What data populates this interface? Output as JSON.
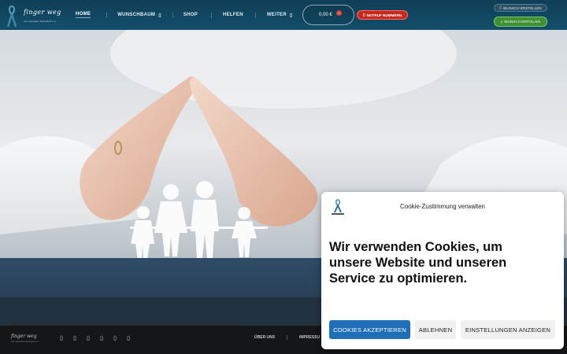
{
  "header": {
    "logo_script": "finger weg",
    "logo_tagline": "vom sexuellen missbrauch e.V.",
    "nav": [
      {
        "label": "HOME",
        "active": true
      },
      {
        "label": "WUNSCHBAUM",
        "has_dropdown": true
      },
      {
        "label": "SHOP"
      },
      {
        "label": "HELFEN"
      },
      {
        "label": "WEITER",
        "has_dropdown": true
      }
    ],
    "cart_price": "0,00 €",
    "cart_count": "0",
    "notruf_label": "NOTRUF NUMMERN",
    "wish_create_label": "WUNSCH ERSTELLEN",
    "wish_fulfil_label": "WUNSCH ERFÜLLEN"
  },
  "footer": {
    "logo_script": "finger weg",
    "logo_tagline": "vom sexuellen missbrauch e.V.",
    "social_icons": [
      "icon-1",
      "icon-2",
      "icon-3",
      "icon-4",
      "icon-5",
      "icon-6"
    ],
    "links": [
      "ÜBER UNS",
      "IMPRESSU"
    ]
  },
  "cookie": {
    "title": "Cookie-Zustimmung verwalten",
    "headline": "Wir verwenden Cookies, um unsere Website und unseren Service zu optimieren.",
    "accept_label": "COOKIES AKZEPTIEREN",
    "deny_label": "ABLEHNEN",
    "settings_label": "EINSTELLUNGEN ANZEIGEN"
  },
  "colors": {
    "header_bg": "#134e6a",
    "notruf_red": "#c8291f",
    "wish_green": "#3f8f33",
    "accept_blue": "#1e6fb8"
  }
}
